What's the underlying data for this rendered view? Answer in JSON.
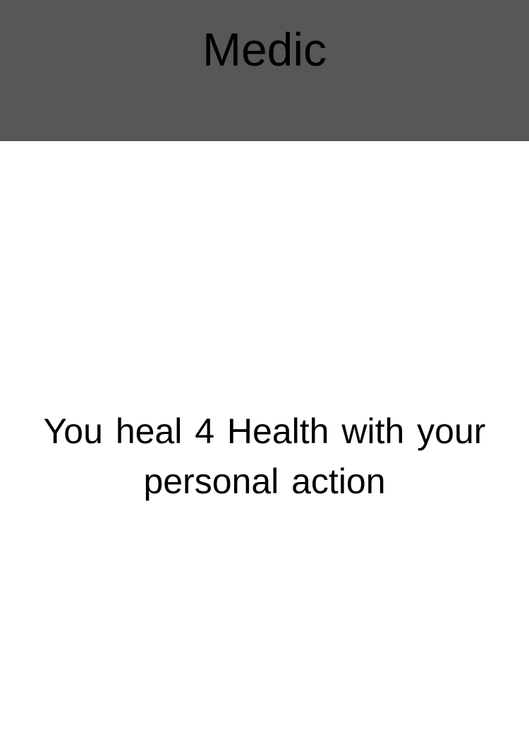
{
  "card": {
    "title": "Medic",
    "description": "You heal 4 Health with your personal action",
    "header_color": "#575757"
  }
}
